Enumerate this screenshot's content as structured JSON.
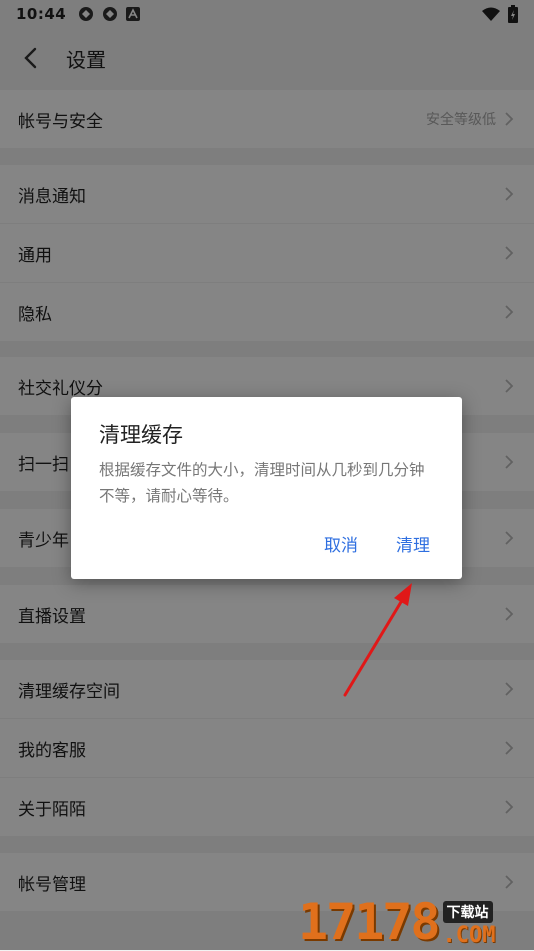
{
  "status_bar": {
    "time": "10:44",
    "left_icons": [
      "sync-icon",
      "sync-icon",
      "app-a-icon"
    ],
    "right_icons": [
      "wifi-icon",
      "battery-charging-icon"
    ]
  },
  "header": {
    "title": "设置"
  },
  "settings": {
    "items": [
      {
        "label": "帐号与安全",
        "sub": "安全等级低"
      },
      {
        "label": "消息通知",
        "sub": ""
      },
      {
        "label": "通用",
        "sub": ""
      },
      {
        "label": "隐私",
        "sub": ""
      },
      {
        "label": "社交礼仪分",
        "sub": ""
      },
      {
        "label": "扫一扫",
        "sub": ""
      },
      {
        "label": "青少年",
        "sub": ""
      },
      {
        "label": "直播设置",
        "sub": ""
      },
      {
        "label": "清理缓存空间",
        "sub": ""
      },
      {
        "label": "我的客服",
        "sub": ""
      },
      {
        "label": "关于陌陌",
        "sub": ""
      },
      {
        "label": "帐号管理",
        "sub": ""
      }
    ]
  },
  "dialog": {
    "title": "清理缓存",
    "message": "根据缓存文件的大小，清理时间从几秒到几分钟不等，请耐心等待。",
    "cancel_label": "取消",
    "confirm_label": "清理"
  },
  "watermark": {
    "number": "17178",
    "site": "下载站",
    "domain": ".COM"
  },
  "colors": {
    "accent": "#2f6fe0",
    "annotation_arrow": "#e01818",
    "watermark": "#e0701c"
  }
}
